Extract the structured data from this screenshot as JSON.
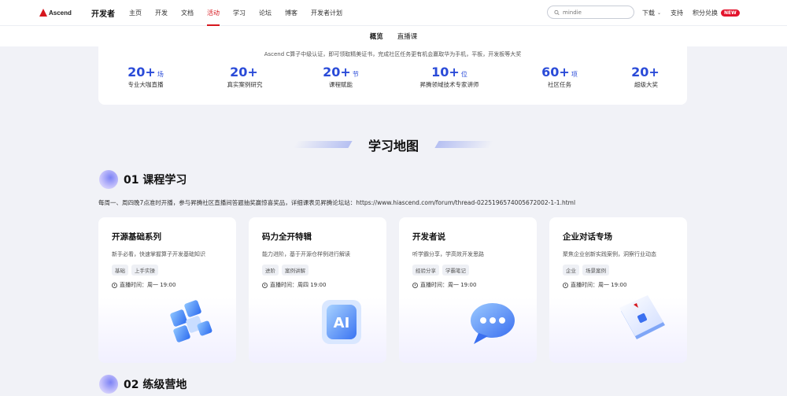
{
  "nav": {
    "logo_text": "Ascend",
    "brand": "开发者",
    "links": [
      "主页",
      "开发",
      "文档",
      "活动",
      "学习",
      "论坛",
      "博客",
      "开发者计划"
    ],
    "active_index": 3,
    "search_placeholder": "mindie",
    "download": "下载",
    "support": "支持",
    "points": "积分兑换",
    "new_badge": "NEW"
  },
  "subnav": {
    "tabs": [
      "概览",
      "直播课"
    ]
  },
  "stats": {
    "description": "Ascend C算子中级认证，即可领取精美证书，完成社区任务更有机会赢取华为手机，平板，开发板等大奖",
    "items": [
      {
        "num": "20+",
        "unit": "场",
        "label": "专业大咖直播"
      },
      {
        "num": "20+",
        "unit": "",
        "label": "真实案例研究"
      },
      {
        "num": "20+",
        "unit": "节",
        "label": "课程赋能"
      },
      {
        "num": "10+",
        "unit": "位",
        "label": "昇腾领域技术专家讲师"
      },
      {
        "num": "60+",
        "unit": "项",
        "label": "社区任务"
      },
      {
        "num": "20+",
        "unit": "",
        "label": "超级大奖"
      }
    ]
  },
  "learning_map": {
    "title": "学习地图"
  },
  "section1": {
    "title": "01 课程学习",
    "description": "每周一、周四晚7点准时开播，参与昇腾社区直播间答题抽奖赢惊喜奖品，详细课表见昇腾论坛站：https://www.hiascend.com/forum/thread-0225196574005672002-1-1.html"
  },
  "section2": {
    "title": "02 练级营地"
  },
  "cards": [
    {
      "title": "开源基础系列",
      "subtitle": "新手必看，快速掌握算子开发基础知识",
      "tags": [
        "基础",
        "上手实操"
      ],
      "time": "直播时间：周一 19:00",
      "icon": "cube-icon"
    },
    {
      "title": "码力全开特辑",
      "subtitle": "能力进阶，基于开源仓样例进行解读",
      "tags": [
        "进阶",
        "案例讲解"
      ],
      "time": "直播时间：周四 19:00",
      "icon": "ai-chip-icon"
    },
    {
      "title": "开发者说",
      "subtitle": "听学霸分享，学高效开发思路",
      "tags": [
        "经验分享",
        "学霸笔记"
      ],
      "time": "直播时间：周一 19:00",
      "icon": "chat-bubble-icon"
    },
    {
      "title": "企业对话专场",
      "subtitle": "聚焦企业创新实践案例，洞察行业动态",
      "tags": [
        "企业",
        "场景案例"
      ],
      "time": "直播时间：周一 19:00",
      "icon": "ascend-book-icon"
    }
  ],
  "colors": {
    "accent": "#2a4bd8",
    "brand_red": "#d6171e",
    "badge_red": "#e3142d"
  }
}
